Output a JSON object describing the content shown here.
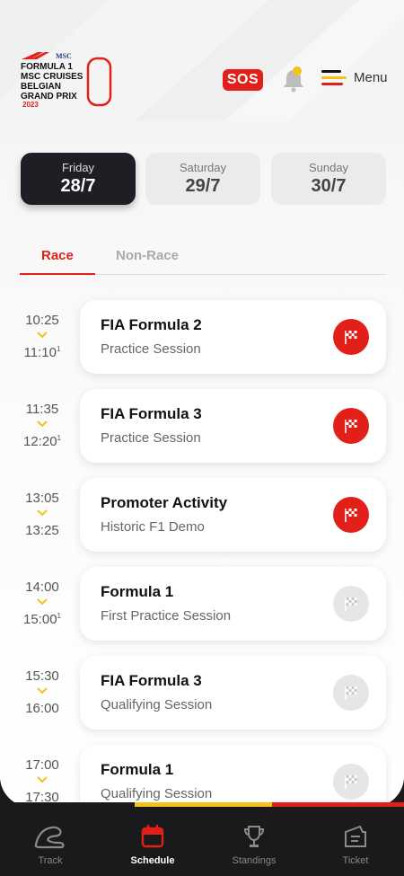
{
  "header": {
    "logo_lines": [
      "MSC",
      "FORMULA 1",
      "MSC CRUISES",
      "BELGIAN",
      "GRAND PRIX",
      "2023"
    ],
    "sos_label": "SOS",
    "menu_label": "Menu",
    "notification_dot": true
  },
  "days": [
    {
      "name": "Friday",
      "date": "28/7",
      "selected": true
    },
    {
      "name": "Saturday",
      "date": "29/7",
      "selected": false
    },
    {
      "name": "Sunday",
      "date": "30/7",
      "selected": false
    }
  ],
  "tabs": [
    {
      "label": "Race",
      "active": true
    },
    {
      "label": "Non-Race",
      "active": false
    }
  ],
  "schedule": [
    {
      "start": "10:25",
      "end": "11:10",
      "end_marker": "1",
      "title": "FIA Formula 2",
      "subtitle": "Practice Session",
      "flag": "active"
    },
    {
      "start": "11:35",
      "end": "12:20",
      "end_marker": "1",
      "title": "FIA Formula 3",
      "subtitle": "Practice Session",
      "flag": "active"
    },
    {
      "start": "13:05",
      "end": "13:25",
      "end_marker": "",
      "title": "Promoter Activity",
      "subtitle": "Historic F1 Demo",
      "flag": "active"
    },
    {
      "start": "14:00",
      "end": "15:00",
      "end_marker": "1",
      "title": "Formula 1",
      "subtitle": "First Practice Session",
      "flag": "inactive"
    },
    {
      "start": "15:30",
      "end": "16:00",
      "end_marker": "",
      "title": "FIA Formula 3",
      "subtitle": "Qualifying Session",
      "flag": "inactive"
    },
    {
      "start": "17:00",
      "end": "17:30",
      "end_marker": "",
      "title": "Formula 1",
      "subtitle": "Qualifying Session",
      "flag": "inactive"
    }
  ],
  "nav": [
    {
      "label": "Track",
      "icon": "track-icon",
      "active": false
    },
    {
      "label": "Schedule",
      "icon": "calendar-icon",
      "active": true
    },
    {
      "label": "Standings",
      "icon": "trophy-icon",
      "active": false
    },
    {
      "label": "Ticket",
      "icon": "ticket-icon",
      "active": false
    }
  ],
  "colors": {
    "accent_red": "#e2201a",
    "accent_yellow": "#f4c21a",
    "dark": "#1e1e24",
    "nav_bg": "#1a1a1c"
  }
}
